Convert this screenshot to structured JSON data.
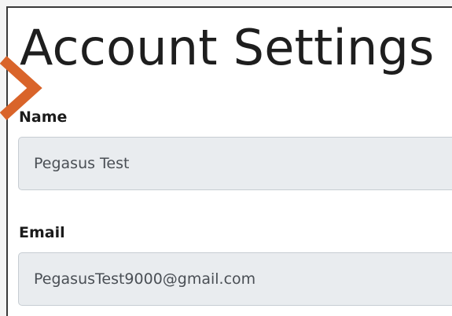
{
  "page": {
    "title": "Account Settings"
  },
  "form": {
    "name": {
      "label": "Name",
      "value": "Pegasus Test"
    },
    "email": {
      "label": "Email",
      "value": "PegasusTest9000@gmail.com"
    }
  },
  "colors": {
    "annotation_arrow": "#d9642a",
    "input_background": "#e9ecef",
    "input_border": "#c7cdd3",
    "title_text": "#1e1e1e"
  },
  "icons": {
    "annotation": "arrow-right-icon"
  }
}
